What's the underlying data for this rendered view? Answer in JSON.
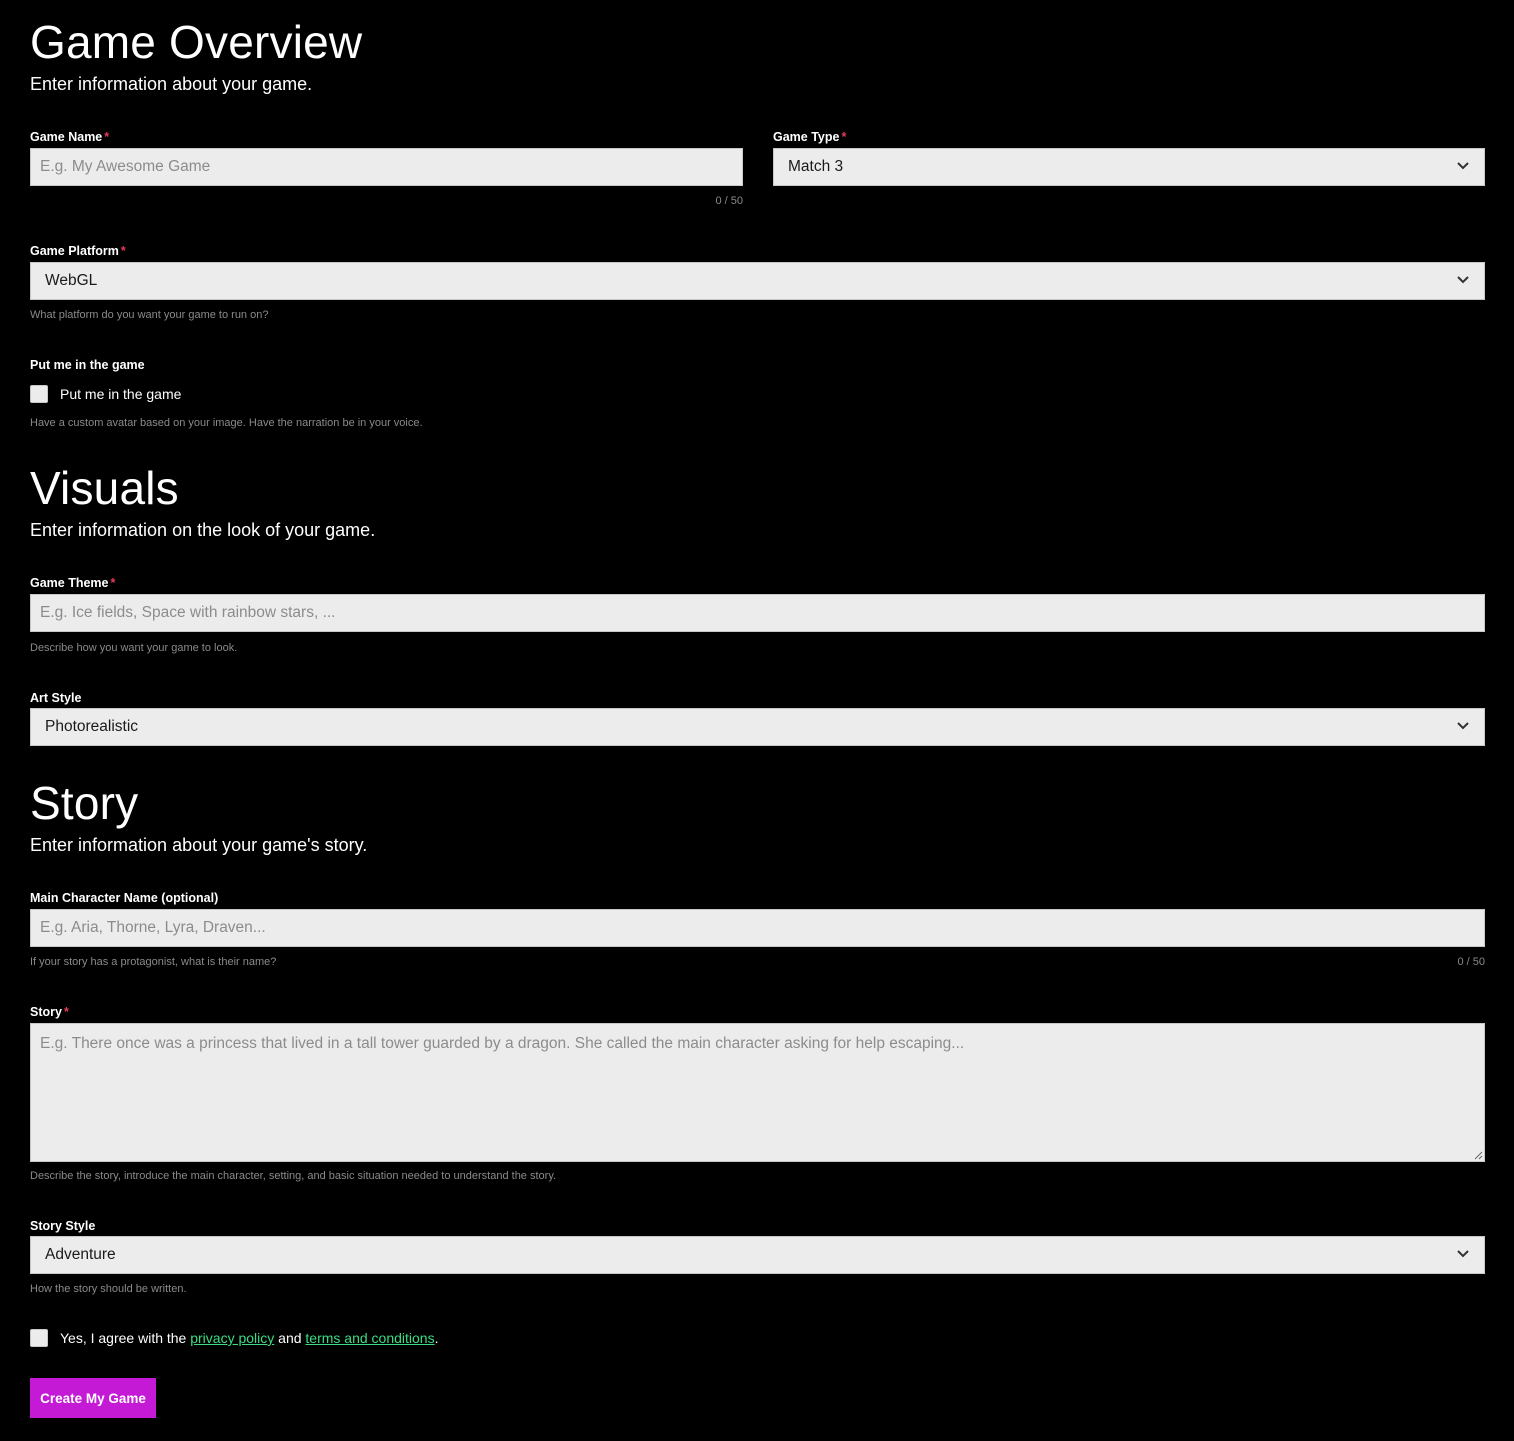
{
  "overview": {
    "title": "Game Overview",
    "subtitle": "Enter information about your game.",
    "game_name": {
      "label": "Game Name",
      "placeholder": "E.g. My Awesome Game",
      "value": "",
      "counter": "0 / 50"
    },
    "game_type": {
      "label": "Game Type",
      "value": "Match 3"
    },
    "game_platform": {
      "label": "Game Platform",
      "value": "WebGL",
      "hint": "What platform do you want your game to run on?"
    },
    "put_me_in_game": {
      "label": "Put me in the game",
      "checkbox_label": "Put me in the game",
      "checked": false,
      "hint": "Have a custom avatar based on your image. Have the narration be in your voice."
    }
  },
  "visuals": {
    "title": "Visuals",
    "subtitle": "Enter information on the look of your game.",
    "game_theme": {
      "label": "Game Theme",
      "placeholder": "E.g. Ice fields, Space with rainbow stars, ...",
      "hint": "Describe how you want your game to look."
    },
    "art_style": {
      "label": "Art Style",
      "value": "Photorealistic"
    }
  },
  "story": {
    "title": "Story",
    "subtitle": "Enter information about your game's story.",
    "main_character": {
      "label": "Main Character Name (optional)",
      "placeholder": "E.g. Aria, Thorne, Lyra, Draven...",
      "hint": "If your story has a protagonist, what is their name?",
      "counter": "0 / 50"
    },
    "story_text": {
      "label": "Story",
      "placeholder": "E.g. There once was a princess that lived in a tall tower guarded by a dragon. She called the main character asking for help escaping...",
      "hint": "Describe the story, introduce the main character, setting, and basic situation needed to understand the story."
    },
    "story_style": {
      "label": "Story Style",
      "value": "Adventure",
      "hint": "How the story should be written."
    }
  },
  "agreement": {
    "prefix": "Yes, I agree with the ",
    "privacy_link": "privacy policy",
    "middle": " and ",
    "terms_link": "terms and conditions",
    "suffix": ".",
    "checked": false
  },
  "submit": {
    "label": "Create My Game"
  },
  "required_mark": "*",
  "colors": {
    "background": "#000000",
    "field_bg": "#ececec",
    "accent_button": "#c41ad6",
    "link": "#3ddc84",
    "required": "#e53b5a",
    "hint": "#8a8a8a"
  }
}
